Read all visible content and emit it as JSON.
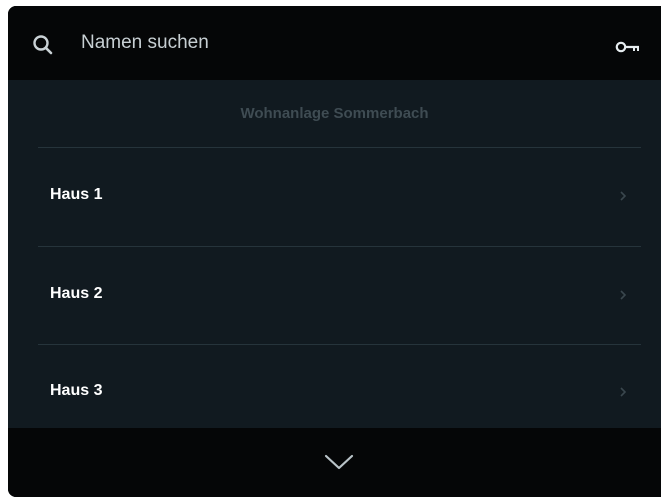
{
  "search": {
    "placeholder": "Namen suchen"
  },
  "header": {
    "title": "Wohnanlage Sommerbach"
  },
  "list": {
    "items": [
      {
        "label": "Haus 1"
      },
      {
        "label": "Haus 2"
      },
      {
        "label": "Haus 3"
      }
    ]
  },
  "icons": {
    "search": "search-icon",
    "key": "key-icon",
    "item_chevron": "chevron-right-icon",
    "scroll_down": "chevron-down-icon"
  },
  "colors": {
    "background": "#111a20",
    "bar": "#050607",
    "divider": "#26343b",
    "subtitle": "#3f4c53",
    "text": "#ffffff"
  }
}
